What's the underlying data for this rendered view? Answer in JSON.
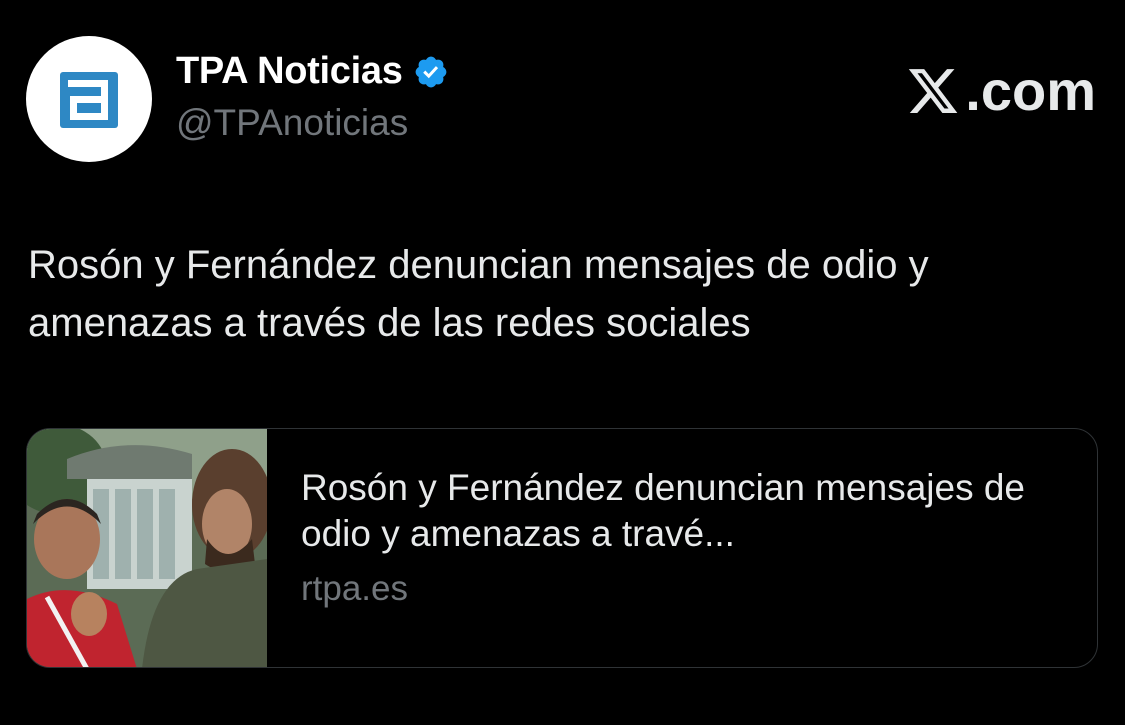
{
  "author": {
    "display_name": "TPA Noticias",
    "handle": "@TPAnoticias",
    "verified": true,
    "logo_color": "#2e88c4"
  },
  "brand": {
    "label": ".com"
  },
  "tweet": {
    "text": "Rosón y Fernández denuncian mensajes de odio y amenazas a través de las redes sociales"
  },
  "link_card": {
    "title": "Rosón y Fernández denuncian mensajes de odio y amenazas a travé...",
    "domain": "rtpa.es"
  },
  "colors": {
    "background": "#000000",
    "verified_badge": "#1d9bf0",
    "secondary_text": "#71767b"
  }
}
